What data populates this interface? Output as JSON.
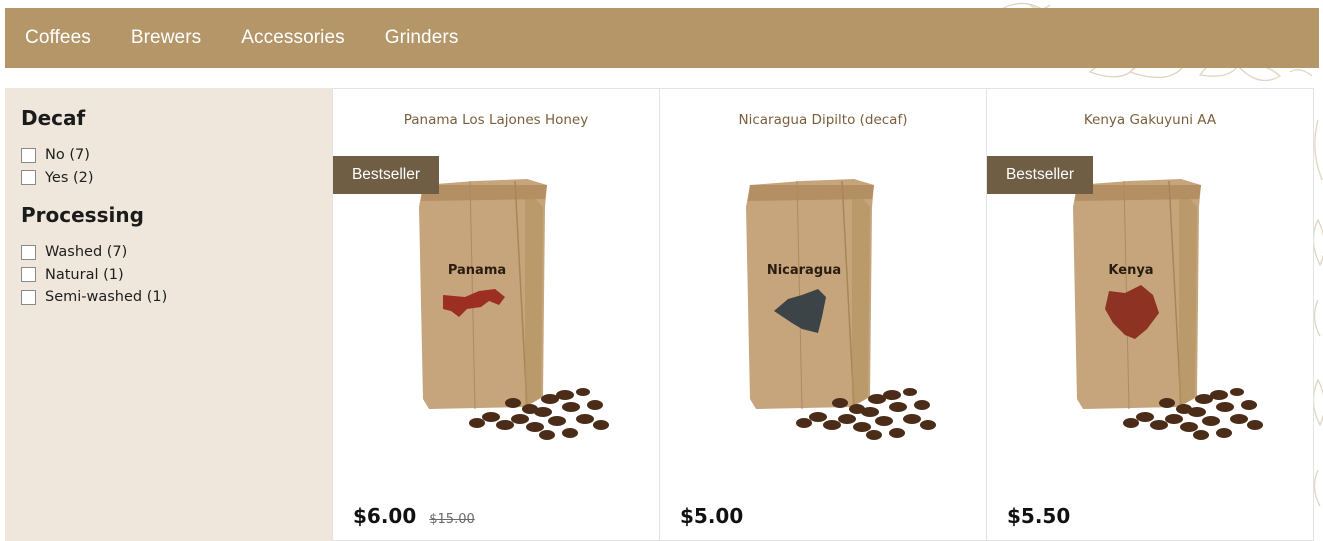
{
  "nav": {
    "items": [
      {
        "label": "Coffees"
      },
      {
        "label": "Brewers"
      },
      {
        "label": "Accessories"
      },
      {
        "label": "Grinders"
      }
    ]
  },
  "filters": {
    "decaf": {
      "title": "Decaf",
      "options": [
        {
          "label": "No (7)",
          "checked": false
        },
        {
          "label": "Yes (2)",
          "checked": false
        }
      ]
    },
    "processing": {
      "title": "Processing",
      "options": [
        {
          "label": "Washed (7)",
          "checked": false
        },
        {
          "label": "Natural (1)",
          "checked": false
        },
        {
          "label": "Semi-washed (1)",
          "checked": false
        }
      ]
    }
  },
  "products": [
    {
      "title": "Panama Los Lajones Honey",
      "badge": "Bestseller",
      "bag_label": "Panama",
      "price": "$6.00",
      "old_price": "$15.00",
      "map_color": "#9c2f22"
    },
    {
      "title": "Nicaragua Dipilto (decaf)",
      "badge": "",
      "bag_label": "Nicaragua",
      "price": "$5.00",
      "old_price": "",
      "map_color": "#3c4447"
    },
    {
      "title": "Kenya Gakuyuni AA",
      "badge": "Bestseller",
      "bag_label": "Kenya",
      "price": "$5.50",
      "old_price": "",
      "map_color": "#8e3324"
    }
  ],
  "colors": {
    "nav_bg": "#b59668",
    "sidebar_bg": "#efe7dc",
    "badge_bg": "#6f5d44",
    "title_text": "#7b5e3b"
  }
}
